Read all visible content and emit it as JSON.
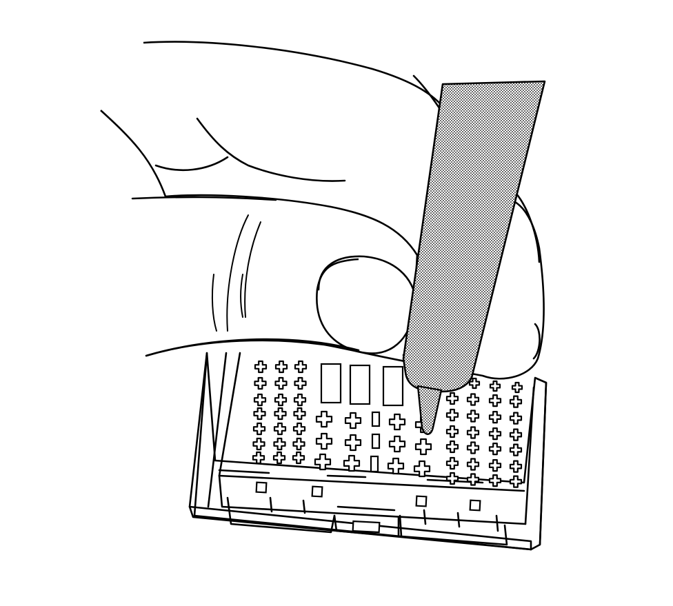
{
  "figure": {
    "subject": "hand-probe-connector-terminal",
    "colors": {
      "line": "#000000",
      "background": "#ffffff",
      "probe_stipple": "#000000"
    },
    "icons": [
      "hand-icon",
      "test-probe-icon",
      "connector-icon"
    ]
  }
}
